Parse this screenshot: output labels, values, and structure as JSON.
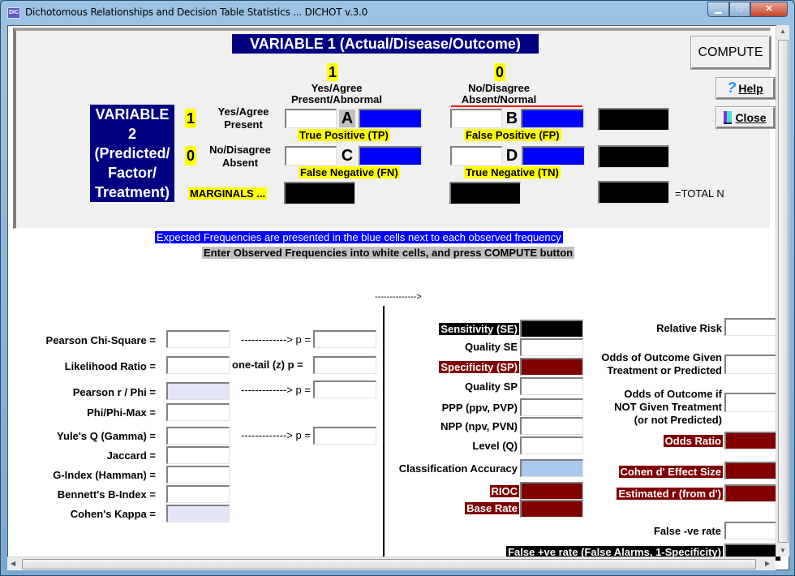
{
  "window": {
    "title": "Dichotomous Relationships and Decision Table Statistics ... DICHOT v.3.0",
    "icon": "app-icon",
    "controls": {
      "minimize": "—",
      "maximize": "□",
      "close": "X"
    }
  },
  "header": {
    "variable1_title": "VARIABLE 1 (Actual/Disease/Outcome)",
    "variable2_title_lines": [
      "VARIABLE",
      "2",
      "(Predicted/",
      "Factor/",
      "Treatment)"
    ],
    "col1": {
      "code": "1",
      "line1": "Yes/Agree",
      "line2": "Present/Abnormal"
    },
    "col0": {
      "code": "0",
      "line1": "No/Disagree",
      "line2": "Absent/Normal"
    },
    "row1": {
      "code": "1",
      "line1": "Yes/Agree",
      "line2": "Present"
    },
    "row0": {
      "code": "0",
      "line1": "No/Disagree",
      "line2": "Absent"
    },
    "marginals_label": "MARGINALS ...",
    "total_label": "=TOTAL N"
  },
  "cells": {
    "A": {
      "letter": "A",
      "caption": "True Positive (TP)",
      "observed": "",
      "expected": ""
    },
    "B": {
      "letter": "B",
      "caption": "False Positive (FP)",
      "observed": "",
      "expected": ""
    },
    "C": {
      "letter": "C",
      "caption": "False Negative (FN)",
      "observed": "",
      "expected": ""
    },
    "D": {
      "letter": "D",
      "caption": "True Negative (TN)",
      "observed": "",
      "expected": ""
    }
  },
  "buttons": {
    "compute": "COMPUTE",
    "help": "Help",
    "help_icon": "question-mark-icon",
    "close": "Close",
    "close_icon": "door-exit-icon"
  },
  "instructions": {
    "expected": "Expected Frequencies are presented in the blue cells next to each observed frequency",
    "observed": "Enter Observed Frequencies into white cells, and press COMPUTE button"
  },
  "arrow_text": "-------------->",
  "arrow_short": "------------->",
  "left_stats": [
    {
      "label": "Pearson Chi-Square =",
      "value": "",
      "p_prefix": "------------->  p =",
      "p_value": ""
    },
    {
      "label": "Likelihood Ratio =",
      "value": "",
      "p_prefix": "one-tail (z)  p =",
      "p_value": ""
    },
    {
      "label": "Pearson r / Phi =",
      "value": "",
      "p_prefix": "------------->  p =",
      "p_value": ""
    },
    {
      "label": "Phi/Phi-Max =",
      "value": ""
    },
    {
      "label": "Yule's Q (Gamma) =",
      "value": "",
      "p_prefix": "------------->  p =",
      "p_value": ""
    },
    {
      "label": "Jaccard =",
      "value": ""
    },
    {
      "label": "G-Index (Hamman) =",
      "value": ""
    },
    {
      "label": "Bennett's B-Index =",
      "value": ""
    },
    {
      "label": "Cohen's Kappa =",
      "value": ""
    }
  ],
  "middle_stats": [
    {
      "label": "Sensitivity (SE)",
      "value": ""
    },
    {
      "label": "Quality SE",
      "value": ""
    },
    {
      "label": "Specificity (SP)",
      "value": ""
    },
    {
      "label": "Quality SP",
      "value": ""
    },
    {
      "label": "PPP (ppv, PVP)",
      "value": ""
    },
    {
      "label": "NPP (npv, PVN)",
      "value": ""
    },
    {
      "label": "Level (Q)",
      "value": ""
    },
    {
      "label": "Classification Accuracy",
      "value": ""
    },
    {
      "label": "RIOC",
      "value": ""
    },
    {
      "label": "Base Rate",
      "value": ""
    },
    {
      "label": "False +ve rate (False Alarms, 1-Specificity)",
      "value": ""
    }
  ],
  "right_stats": [
    {
      "label": "Relative Risk",
      "value": ""
    },
    {
      "label_lines": [
        "Odds of Outcome Given",
        "Treatment or Predicted"
      ],
      "value": ""
    },
    {
      "label_lines": [
        "Odds of Outcome if",
        "NOT Given Treatment",
        "(or not Predicted)"
      ],
      "value": ""
    },
    {
      "label": "Odds Ratio",
      "value": ""
    },
    {
      "label": "Cohen d' Effect Size",
      "value": ""
    },
    {
      "label": "Estimated r (from d')",
      "value": ""
    },
    {
      "label": "False -ve rate",
      "value": ""
    }
  ],
  "colors": {
    "header_navy": "#000080",
    "highlight_yellow": "#ffff00",
    "expected_blue": "#0000ff",
    "result_maroon": "#800000",
    "accent_red_line": "#ff0000"
  }
}
